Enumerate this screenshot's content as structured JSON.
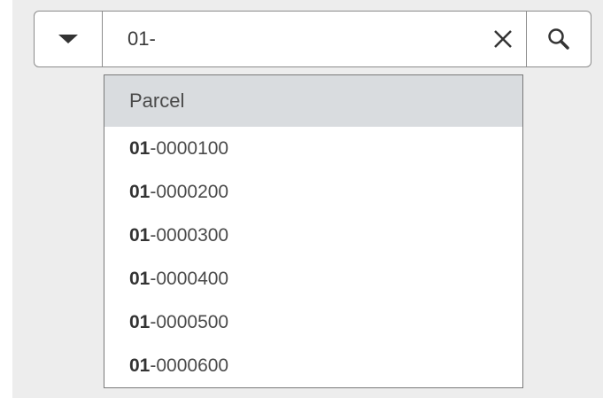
{
  "search": {
    "value": "01-",
    "source_icon": "caret-down-icon",
    "clear_icon": "close-icon",
    "search_icon": "search-icon"
  },
  "suggestions": {
    "header": "Parcel",
    "items": [
      {
        "match": "01",
        "rest": "-0000100"
      },
      {
        "match": "01",
        "rest": "-0000200"
      },
      {
        "match": "01",
        "rest": "-0000300"
      },
      {
        "match": "01",
        "rest": "-0000400"
      },
      {
        "match": "01",
        "rest": "-0000500"
      },
      {
        "match": "01",
        "rest": "-0000600"
      }
    ]
  }
}
